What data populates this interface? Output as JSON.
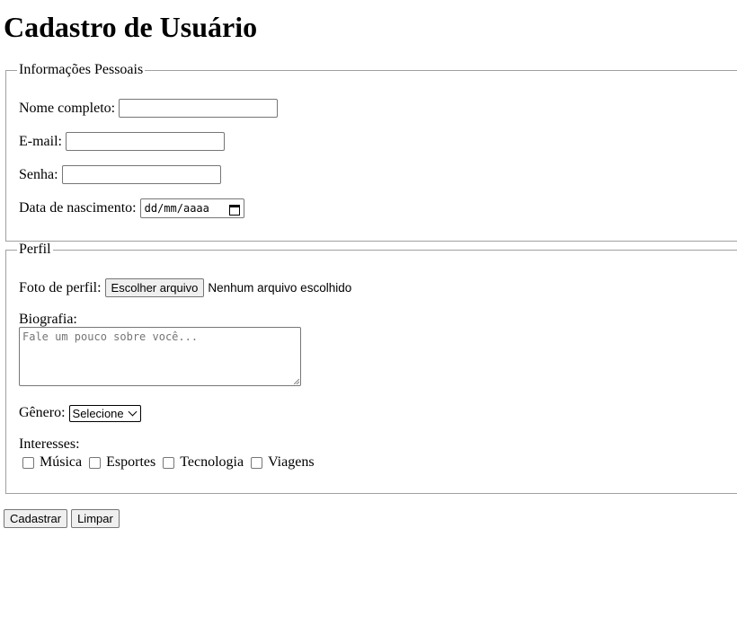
{
  "page_title": "Cadastro de Usuário",
  "personal": {
    "legend": "Informações Pessoais",
    "full_name_label": "Nome completo:",
    "email_label": "E-mail:",
    "password_label": "Senha:",
    "birthdate_label": "Data de nascimento:",
    "birthdate_placeholder": "dd/mm/aaaa",
    "full_name_value": "",
    "email_value": "",
    "password_value": ""
  },
  "profile": {
    "legend": "Perfil",
    "photo_label": "Foto de perfil:",
    "choose_file_button": "Escolher arquivo",
    "no_file_text": "Nenhum arquivo escolhido",
    "bio_label": "Biografia:",
    "bio_placeholder": "Fale um pouco sobre você...",
    "gender_label": "Gênero:",
    "gender_selected": "Selecione",
    "interests_label": "Interesses:",
    "interests": [
      {
        "label": "Música",
        "checked": false
      },
      {
        "label": "Esportes",
        "checked": false
      },
      {
        "label": "Tecnologia",
        "checked": false
      },
      {
        "label": "Viagens",
        "checked": false
      }
    ]
  },
  "actions": {
    "submit_label": "Cadastrar",
    "reset_label": "Limpar"
  },
  "icons": {
    "date_picker": "calendar-icon",
    "select_arrow": "chevron-down-icon"
  }
}
